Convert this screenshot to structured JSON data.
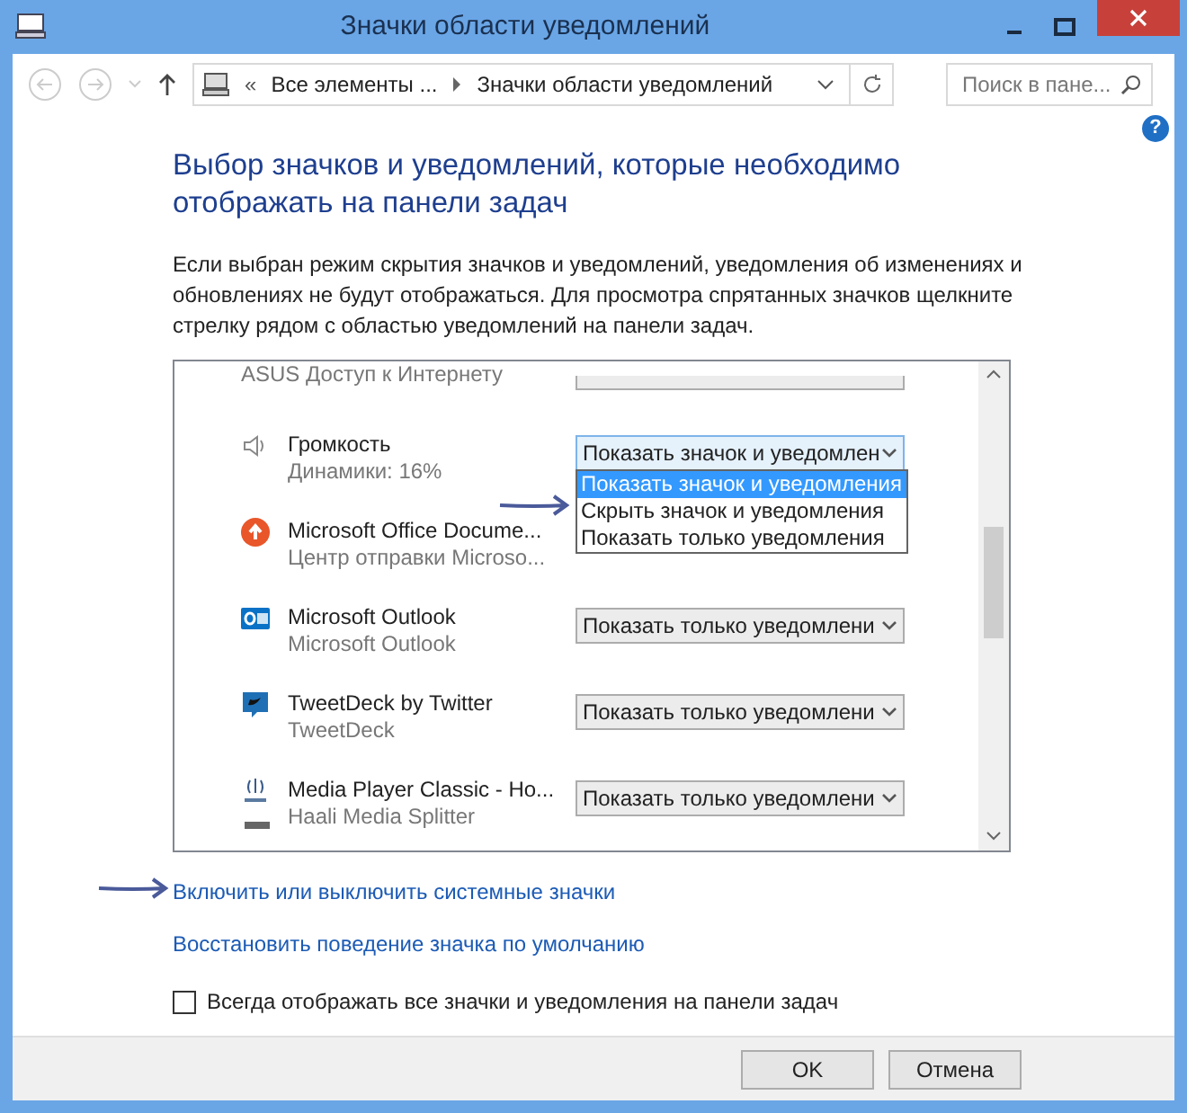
{
  "window": {
    "title": "Значки области уведомлений"
  },
  "address_bar": {
    "prefix": "«",
    "crumbs": [
      "Все элементы ...",
      "Значки области уведомлений"
    ]
  },
  "search": {
    "placeholder": "Поиск в пане..."
  },
  "help": "?",
  "heading": "Выбор значков и уведомлений, которые необходимо отображать на панели задач",
  "description": "Если выбран режим скрытия значков и уведомлений, уведомления об изменениях и обновлениях не будут отображаться. Для просмотра спрятанных значков щелкните стрелку рядом с областью уведомлений на панели задач.",
  "partial_row": {
    "subtitle": "ASUS Доступ к Интернету"
  },
  "rows": [
    {
      "name": "Громкость",
      "subtitle": "Динамики: 16%",
      "value": "Показать значок и уведомлен",
      "open": true
    },
    {
      "name": "Microsoft Office Docume...",
      "subtitle": "Центр отправки Microso..."
    },
    {
      "name": "Microsoft Outlook",
      "subtitle": "Microsoft Outlook",
      "value": "Показать только уведомлени",
      "open": false
    },
    {
      "name": "TweetDeck by Twitter",
      "subtitle": "TweetDeck",
      "value": "Показать только уведомлени",
      "open": false
    },
    {
      "name": "Media Player Classic - Ho...",
      "subtitle": "Haali Media Splitter",
      "value": "Показать только уведомлени",
      "open": false
    }
  ],
  "dropdown_options": [
    {
      "label": "Показать значок и уведомления",
      "selected": true
    },
    {
      "label": "Скрыть значок и уведомления",
      "selected": false
    },
    {
      "label": "Показать только уведомления",
      "selected": false
    }
  ],
  "links": [
    "Включить или выключить системные значки",
    "Восстановить поведение значка по умолчанию"
  ],
  "always_show": {
    "label": "Всегда отображать все значки и уведомления на панели задач",
    "checked": false
  },
  "buttons": [
    "OK",
    "Отмена"
  ]
}
